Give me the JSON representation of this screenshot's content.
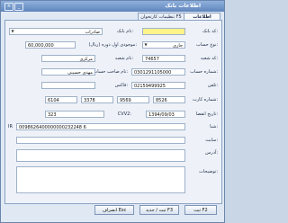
{
  "window": {
    "title": "اطلاعات بانک",
    "minimize": "_",
    "close": "×"
  },
  "tabs": [
    {
      "label": "اطلاعات عمومی F4"
    },
    {
      "label": "تنظیمات کارتخوان F5"
    }
  ],
  "form": {
    "code_label": "کد بانک:",
    "code_value": "",
    "bank_name_label": "نام بانک:",
    "bank_name_value": "صادرات",
    "account_type_label": "نوع حساب:",
    "account_type_value": "جاری",
    "opening_balance_label": "موجودی اول دوره (ریال):",
    "opening_balance_value": "60,000,000",
    "branch_code_label": "کد شعبه:",
    "branch_code_value": "74657",
    "branch_name_label": "نام شعبه:",
    "branch_name_value": "مرکزی",
    "account_number_label": "شماره حساب:",
    "account_number_value": "0301291105000",
    "owner_label": "نام صاحب حساب:",
    "owner_value": "مهدی حسینی",
    "phone_label": "تلفن:",
    "phone_value": "02159499925",
    "fax_label": "فاکس:",
    "fax_value": "",
    "card_number_label": "شماره کارت:",
    "card_parts": [
      "6104",
      "3378",
      "9569",
      "8526"
    ],
    "card_expiry_label": "تاریخ انقضا:",
    "card_expiry_value": "1394/09/03",
    "cvv2_label": "CVV2:",
    "cvv2_value": "323",
    "sheba_label": "شبا:",
    "sheba_prefix": "IR",
    "sheba_value": "0098626400000000232248 6",
    "website_label": "سایت:",
    "website_value": "",
    "address_label": "آدرس:",
    "address_value": "",
    "notes_label": "توضیحات:",
    "notes_value": ""
  },
  "buttons": {
    "save": "ثبت F2",
    "save_new": "ثبت / جدید F3",
    "cancel": "انصراف Esc"
  }
}
